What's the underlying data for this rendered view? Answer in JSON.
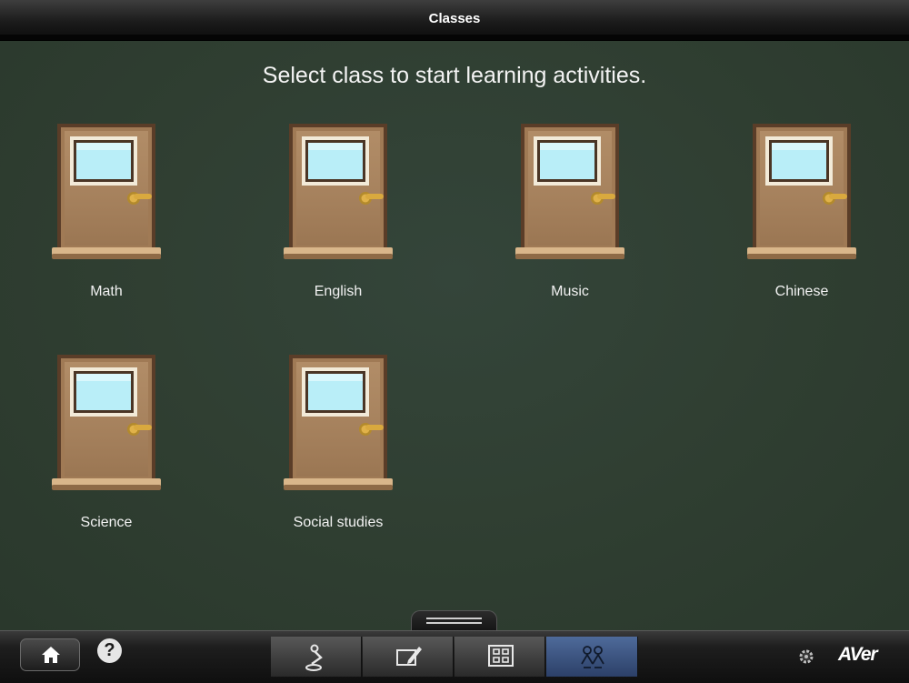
{
  "window": {
    "title": "Classes"
  },
  "main": {
    "instruction": "Select class to start learning activities.",
    "classes": [
      {
        "label": "Math"
      },
      {
        "label": "English"
      },
      {
        "label": "Music"
      },
      {
        "label": "Chinese"
      },
      {
        "label": "Science"
      },
      {
        "label": "Social studies"
      }
    ]
  },
  "toolbar": {
    "help_label": "?",
    "brand": "AVer",
    "tabs": [
      {
        "icon": "document-camera-icon",
        "active": false
      },
      {
        "icon": "whiteboard-pen-icon",
        "active": false
      },
      {
        "icon": "grid-layout-icon",
        "active": false
      },
      {
        "icon": "classes-students-icon",
        "active": true
      }
    ],
    "icons": {
      "home": "home-icon",
      "settings": "gear-icon"
    }
  },
  "colors": {
    "board": "#2f3e30",
    "active_tab": "#3d5582",
    "door": "#a07a55",
    "door_window": "#b9eef8",
    "door_knob": "#d3a43a"
  }
}
